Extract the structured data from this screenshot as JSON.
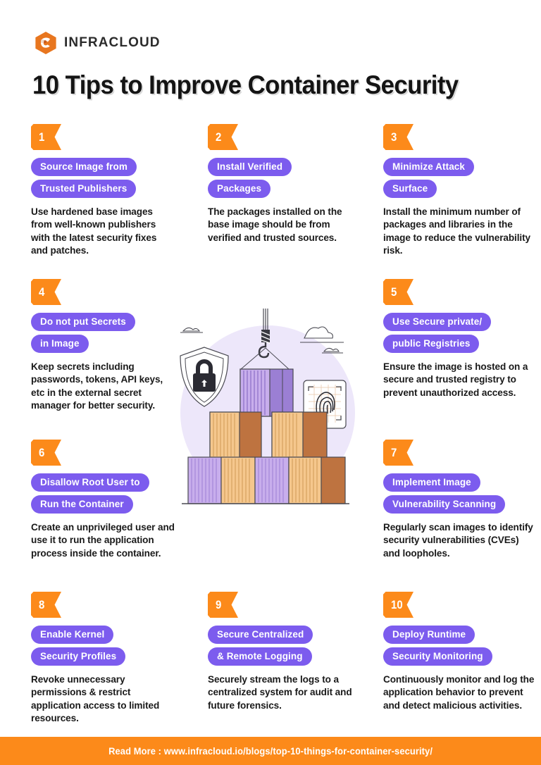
{
  "brand": {
    "name": "INFRACLOUD",
    "logo_icon": "infracloud-hexagon-logo",
    "accent_orange": "#FC8A1A",
    "accent_purple": "#7C5CEE"
  },
  "header": {
    "title": "10 Tips to Improve Container Security"
  },
  "tips": [
    {
      "number": "1",
      "pill_line_1": "Source Image from",
      "pill_line_2": "Trusted Publishers",
      "body": "Use hardened base images from well-known publishers with the latest security fixes and patches."
    },
    {
      "number": "2",
      "pill_line_1": "Install Verified",
      "pill_line_2": "Packages",
      "body": "The packages installed on the base image should be from verified and trusted sources."
    },
    {
      "number": "3",
      "pill_line_1": "Minimize Attack",
      "pill_line_2": "Surface",
      "body": "Install the minimum number of packages and libraries in the image to reduce the vulnerability risk."
    },
    {
      "number": "4",
      "pill_line_1": "Do not put Secrets",
      "pill_line_2": "in Image",
      "body": "Keep secrets including passwords, tokens, API keys, etc in the external secret manager for better security."
    },
    {
      "number": "5",
      "pill_line_1": "Use Secure private/",
      "pill_line_2": "public Registries",
      "body": "Ensure the image is hosted on a secure and trusted registry to prevent unauthorized access."
    },
    {
      "number": "6",
      "pill_line_1": "Disallow Root User to",
      "pill_line_2": "Run the Container",
      "body": "Create an unprivileged user and use it to run the application process inside the container."
    },
    {
      "number": "7",
      "pill_line_1": "Implement Image",
      "pill_line_2": "Vulnerability Scanning",
      "body": "Regularly scan images to identify security vulnerabilities (CVEs) and loopholes."
    },
    {
      "number": "8",
      "pill_line_1": "Enable Kernel",
      "pill_line_2": "Security Profiles",
      "body": "Revoke unnecessary permissions & restrict application access to limited resources."
    },
    {
      "number": "9",
      "pill_line_1": "Secure Centralized",
      "pill_line_2": "& Remote Logging",
      "body": "Securely stream the logs to a centralized system for audit and future forensics."
    },
    {
      "number": "10",
      "pill_line_1": "Deploy Runtime",
      "pill_line_2": "Security Monitoring",
      "body": "Continuously monitor and log the application behavior to prevent and detect malicious activities."
    }
  ],
  "illustration": {
    "name": "container-security-illustration",
    "elements": [
      "stacked-shipping-containers",
      "crane-hook",
      "shield-with-padlock-icon",
      "fingerprint-scanner-icon",
      "clouds"
    ]
  },
  "footer": {
    "text": "Read More : www.infracloud.io/blogs/top-10-things-for-container-security/"
  }
}
